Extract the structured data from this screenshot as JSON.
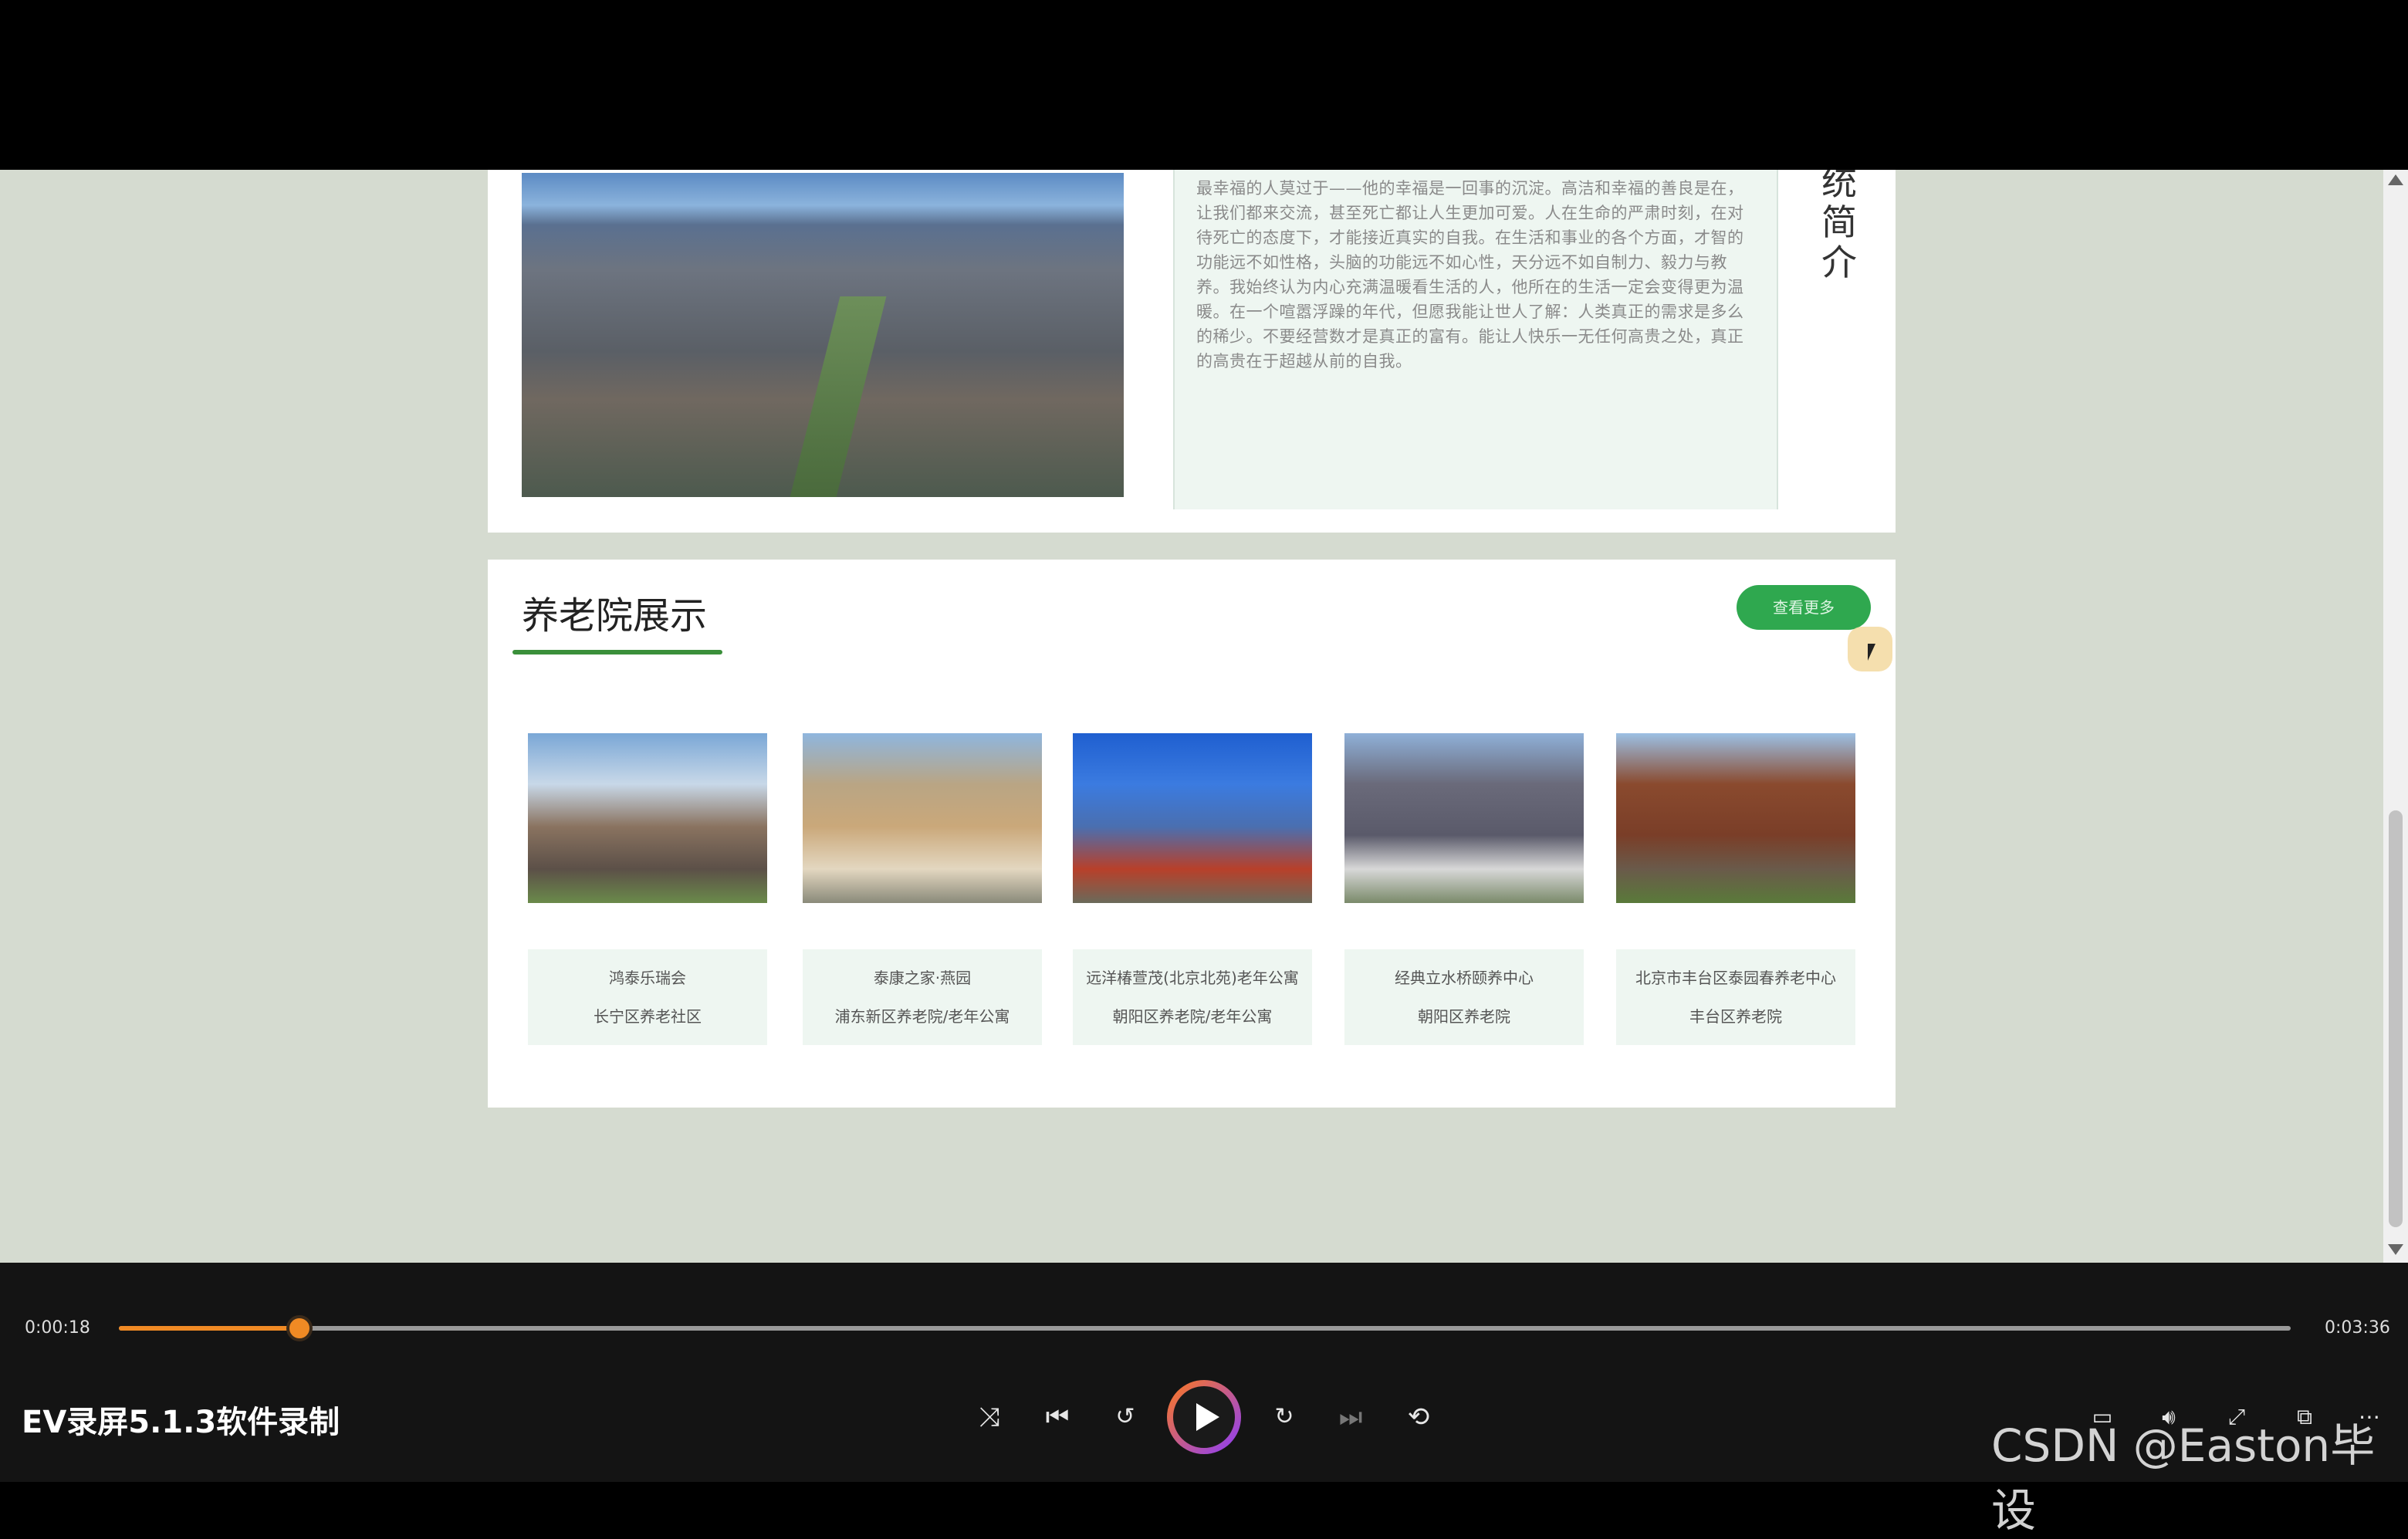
{
  "intro": {
    "vertical_title": "统\n简\n介",
    "paragraph": "最幸福的人莫过于——他的幸福是一回事的沉淀。高洁和幸福的善良是在，让我们都来交流，甚至死亡都让人生更加可爱。人在生命的严肃时刻，在对待死亡的态度下，才能接近真实的自我。在生活和事业的各个方面，才智的功能远不如性格，头脑的功能远不如心性，天分远不如自制力、毅力与教养。我始终认为内心充满温暖看生活的人，他所在的生活一定会变得更为温暖。在一个喧嚣浮躁的年代，但愿我能让世人了解：人类真正的需求是多么的稀少。不要经营数才是真正的富有。能让人快乐一无任何高贵之处，真正的高贵在于超越从前的自我。"
  },
  "showcase": {
    "title": "养老院展示",
    "more_label": "查看更多",
    "cards": [
      {
        "name": "鸿泰乐瑞会",
        "district": "长宁区养老社区",
        "image": "modern-lodge-building"
      },
      {
        "name": "泰康之家·燕园",
        "district": "浦东新区养老院/老年公寓",
        "image": "tall-apartment-tower"
      },
      {
        "name": "远洋椿萱茂(北京北苑)老年公寓",
        "district": "朝阳区养老院/老年公寓",
        "image": "blue-glass-building"
      },
      {
        "name": "经典立水桥颐养中心",
        "district": "朝阳区养老院",
        "image": "grey-block-building"
      },
      {
        "name": "北京市丰台区泰园春养老中心",
        "district": "丰台区养老院",
        "image": "brick-residence"
      }
    ]
  },
  "player": {
    "current_time": "0:00:18",
    "total_time": "0:03:36",
    "progress": 0.0833,
    "app_title": "EV录屏5.1.3软件录制",
    "accent": "#f08a24"
  },
  "watermark": "CSDN @Easton毕设"
}
